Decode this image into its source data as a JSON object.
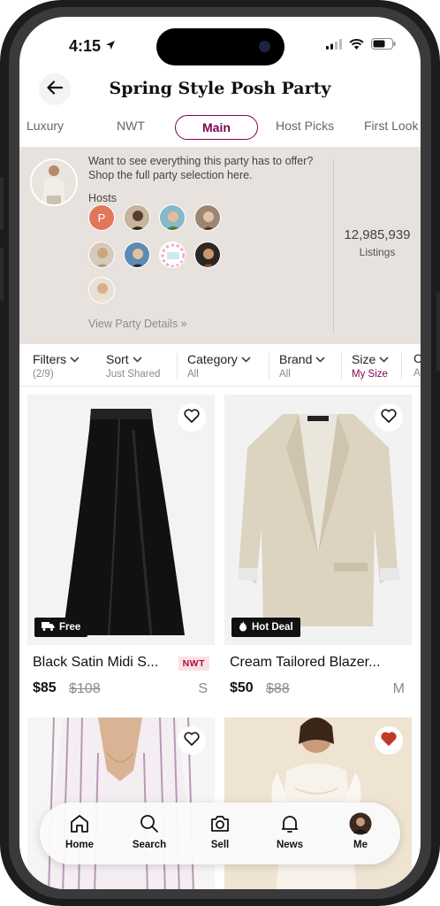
{
  "status_bar": {
    "time": "4:15"
  },
  "header": {
    "title": "Spring Style Posh Party"
  },
  "tabs": [
    {
      "label": "Luxury"
    },
    {
      "label": "NWT"
    },
    {
      "label": "Main"
    },
    {
      "label": "Host Picks"
    },
    {
      "label": "First Look"
    }
  ],
  "party": {
    "description": "Want to see everything this party has to offer? Shop the full party selection here.",
    "hosts_label": "Hosts",
    "host_initial": "P",
    "view_details": "View Party Details »",
    "listings_count": "12,985,939",
    "listings_label": "Listings"
  },
  "filters": [
    {
      "label": "Filters",
      "sub": "(2/9)"
    },
    {
      "label": "Sort",
      "sub": "Just Shared"
    },
    {
      "label": "Category",
      "sub": "All"
    },
    {
      "label": "Brand",
      "sub": "All"
    },
    {
      "label": "Size",
      "sub": "My Size"
    },
    {
      "label": "C",
      "sub": "A"
    }
  ],
  "listings": [
    {
      "title": "Black Satin Midi S...",
      "tag": "NWT",
      "price": "$85",
      "original": "$108",
      "size": "S",
      "badge": "Free",
      "liked": false
    },
    {
      "title": "Cream Tailored Blazer...",
      "price": "$50",
      "original": "$88",
      "size": "M",
      "badge": "Hot Deal",
      "liked": false
    },
    {
      "liked": false
    },
    {
      "liked": true
    }
  ],
  "bottom_nav": [
    {
      "label": "Home"
    },
    {
      "label": "Search"
    },
    {
      "label": "Sell"
    },
    {
      "label": "News"
    },
    {
      "label": "Me"
    }
  ],
  "colors": {
    "accent": "#7f0353",
    "party_bg": "#e7e2de",
    "like_red": "#c0392b"
  }
}
